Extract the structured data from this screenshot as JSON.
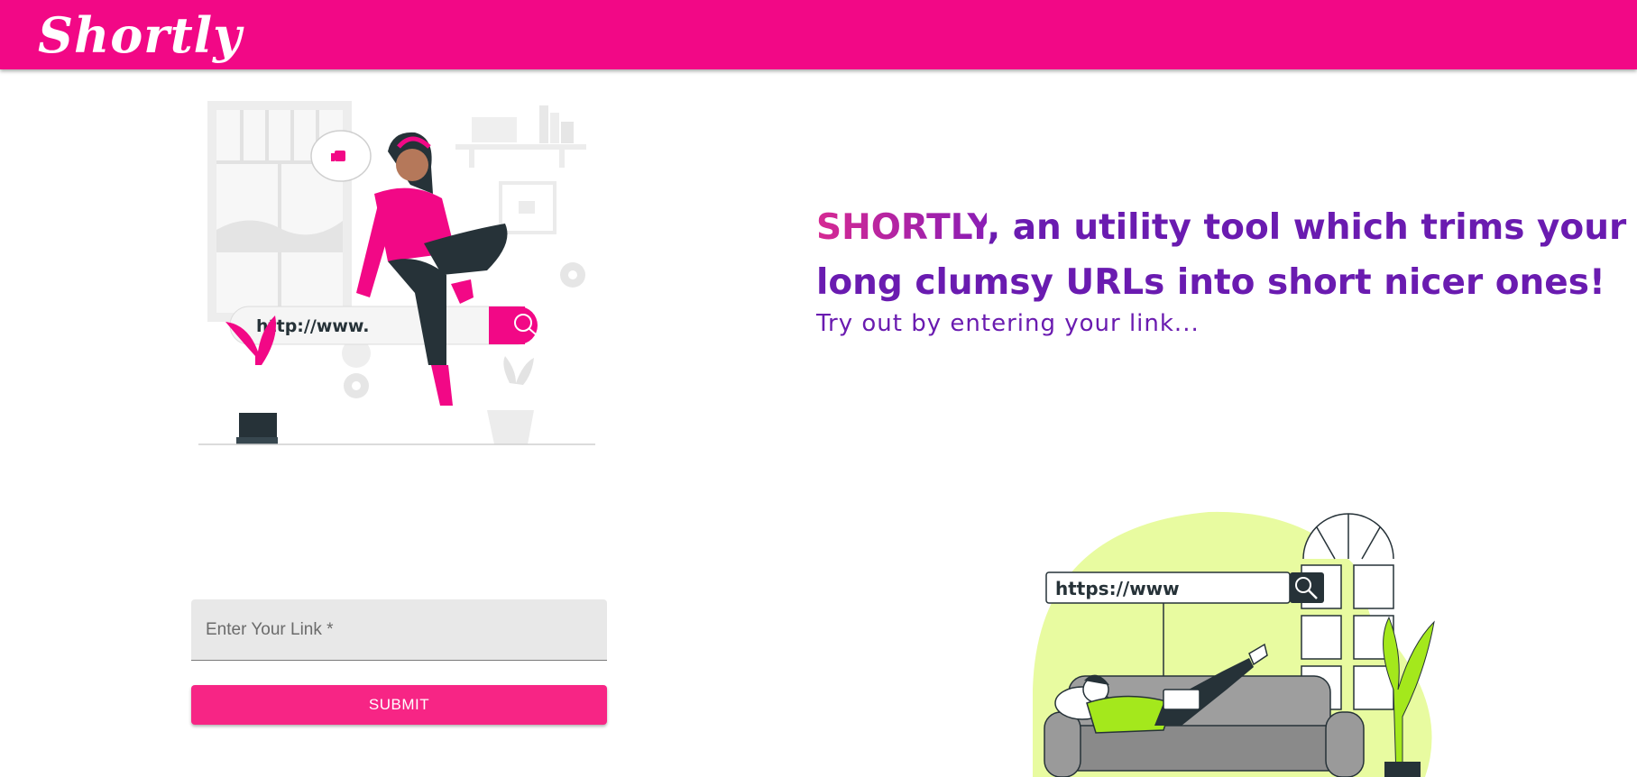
{
  "header": {
    "logo_text": "Shortly"
  },
  "hero": {
    "brand": "SHORTLY",
    "headline_rest": ", an utility tool which trims your long clumsy URLs into short nicer ones!",
    "subline": "Try out by entering your link..."
  },
  "illustrations": {
    "top_search_text": "http://www.",
    "bottom_search_text": "https://www"
  },
  "form": {
    "link_placeholder": "Enter Your Link *",
    "link_value": "",
    "submit_label": "SUBMIT"
  },
  "colors": {
    "brand_pink": "#f20886",
    "button_pink": "#f72585",
    "headline_purple": "#6a1bb0",
    "accent_lime": "#e8fba0"
  }
}
